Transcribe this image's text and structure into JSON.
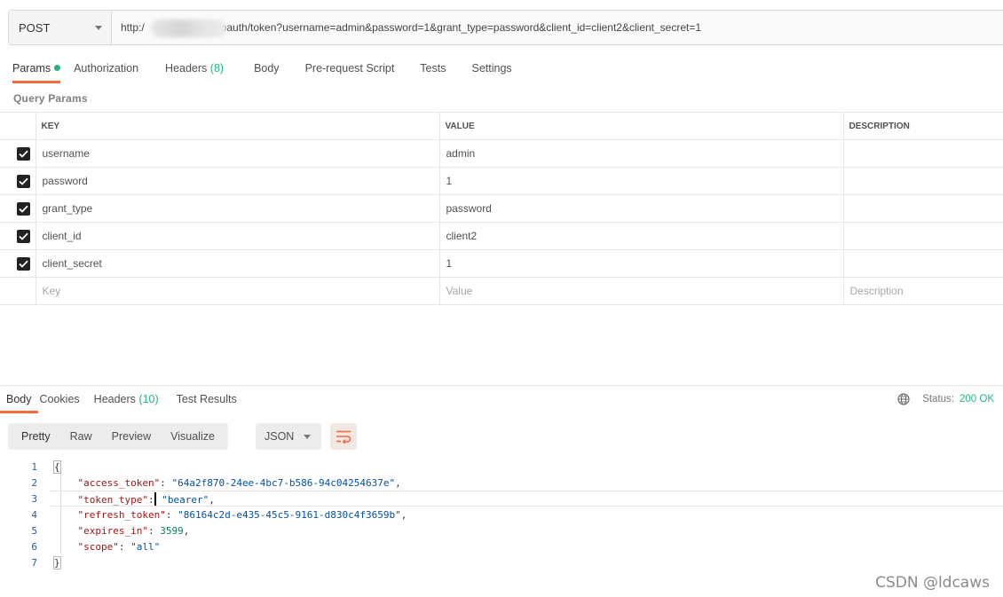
{
  "request": {
    "method": "POST",
    "url_prefix": "http:/",
    "url_suffix": "oauth/token?username=admin&password=1&grant_type=password&client_id=client2&client_secret=1"
  },
  "request_tabs": [
    {
      "label": "Params",
      "active": true
    },
    {
      "label": "Authorization"
    },
    {
      "label": "Headers",
      "count": "(8)"
    },
    {
      "label": "Body"
    },
    {
      "label": "Pre-request Script"
    },
    {
      "label": "Tests"
    },
    {
      "label": "Settings"
    }
  ],
  "query_params": {
    "title": "Query Params",
    "columns": [
      "KEY",
      "VALUE",
      "DESCRIPTION"
    ],
    "rows": [
      {
        "key": "username",
        "value": "admin"
      },
      {
        "key": "password",
        "value": "1"
      },
      {
        "key": "grant_type",
        "value": "password"
      },
      {
        "key": "client_id",
        "value": "client2"
      },
      {
        "key": "client_secret",
        "value": "1"
      }
    ],
    "placeholders": {
      "key": "Key",
      "value": "Value",
      "description": "Description"
    }
  },
  "response_tabs": [
    {
      "label": "Body",
      "active": true
    },
    {
      "label": "Cookies"
    },
    {
      "label": "Headers",
      "count": "(10)"
    },
    {
      "label": "Test Results"
    }
  ],
  "status": {
    "label": "Status:",
    "value": "200 OK"
  },
  "format_buttons": [
    "Pretty",
    "Raw",
    "Preview",
    "Visualize"
  ],
  "format_select": "JSON",
  "response_body": [
    {
      "n": "1",
      "text": "{"
    },
    {
      "n": "2",
      "key": "\"access_token\"",
      "value": "\"64a2f870-24ee-4bc7-b586-94c04254637e\"",
      "type": "s"
    },
    {
      "n": "3",
      "key": "\"token_type\"",
      "value": "\"bearer\"",
      "type": "s"
    },
    {
      "n": "4",
      "key": "\"refresh_token\"",
      "value": "\"86164c2d-e435-45c5-9161-d830c4f3659b\"",
      "type": "s"
    },
    {
      "n": "5",
      "key": "\"expires_in\"",
      "value": "3599",
      "type": "n"
    },
    {
      "n": "6",
      "key": "\"scope\"",
      "value": "\"all\"",
      "type": "s"
    },
    {
      "n": "7",
      "text": "}"
    }
  ],
  "watermark": "CSDN @ldcaws",
  "colors": {
    "accent": "#f26b3a",
    "success": "#26b47f"
  }
}
